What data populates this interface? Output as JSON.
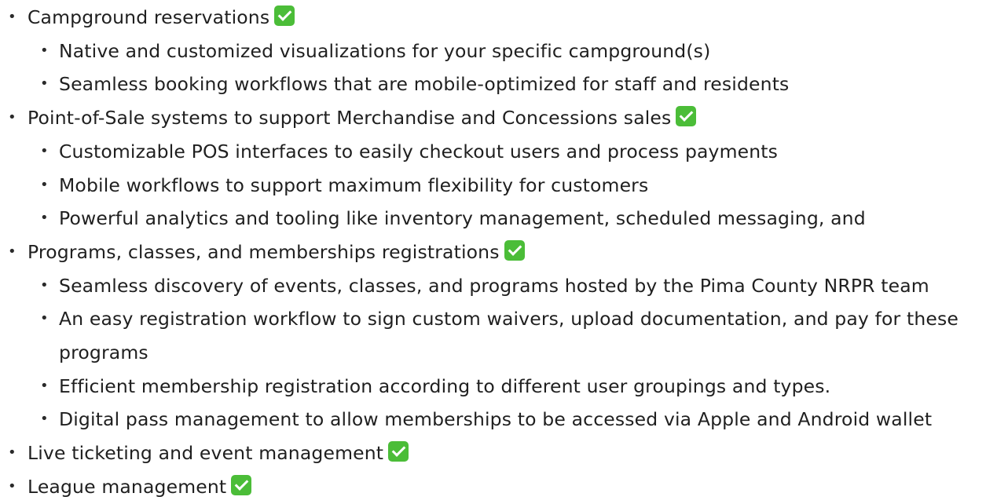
{
  "bullet_glyph": "•",
  "check_icon_color": "#4bbd38",
  "items": [
    {
      "text": "Campground reservations",
      "check": "check-mark-button-icon",
      "children": [
        "Native and customized visualizations for your specific campground(s)",
        "Seamless booking workflows that are mobile-optimized for staff and residents"
      ]
    },
    {
      "text": "Point-of-Sale systems to support Merchandise and Concessions sales",
      "check": "check-mark-button-icon",
      "children": [
        "Customizable POS interfaces to easily checkout users and process payments",
        "Mobile workflows to support maximum flexibility for customers",
        "Powerful analytics and tooling like inventory management, scheduled messaging, and"
      ]
    },
    {
      "text": "Programs, classes, and memberships registrations",
      "check": "check-mark-button-icon",
      "children": [
        "Seamless discovery of events, classes, and programs hosted by the Pima County NRPR team",
        "An easy registration workflow to sign custom waivers, upload documentation, and pay for these programs",
        "Efficient membership registration according to different user groupings and types.",
        "Digital pass management to allow memberships to be accessed via Apple and Android wallet"
      ]
    },
    {
      "text": "Live ticketing and event management",
      "check": "check-mark-button-icon",
      "children": []
    },
    {
      "text": "League management",
      "check": "check-mark-button-icon",
      "children": []
    }
  ]
}
